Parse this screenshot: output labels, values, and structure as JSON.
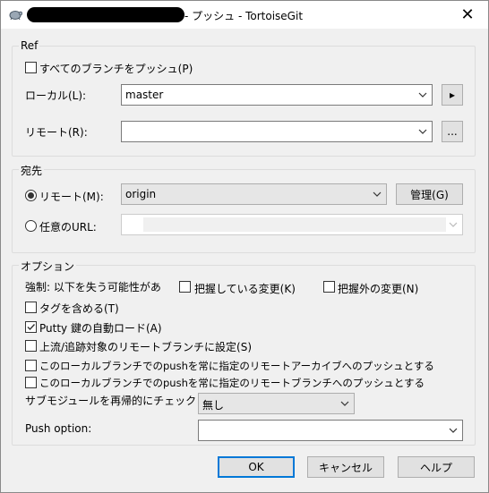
{
  "window": {
    "title": "- プッシュ - TortoiseGit",
    "close": "✕"
  },
  "ref": {
    "legend": "Ref",
    "push_all_branches": "すべてのブランチをプッシュ(P)",
    "local_label": "ローカル(L):",
    "local_value": "master",
    "local_button": "▸",
    "remote_label": "リモート(R):",
    "remote_value": "",
    "remote_button": "..."
  },
  "destination": {
    "legend": "宛先",
    "remote_label": "リモート(M):",
    "remote_value": "origin",
    "manage_button": "管理(G)",
    "url_label": "任意のURL:",
    "url_value": ""
  },
  "options": {
    "legend": "オプション",
    "force_label": "強制: 以下を失う可能性があ",
    "force_known": "把握している変更(K)",
    "force_unknown": "把握外の変更(N)",
    "include_tags": "タグを含める(T)",
    "putty_autoload": "Putty 鍵の自動ロード(A)",
    "set_upstream": "上流/追跡対象のリモートブランチに設定(S)",
    "always_push_archive": "このローカルブランチでのpushを常に指定のリモートアーカイブへのプッシュとする",
    "always_push_branch": "このローカルブランチでのpushを常に指定のリモートブランチへのプッシュとする",
    "recurse_label": "サブモジュールを再帰的にチェック",
    "recurse_value": "無し",
    "push_option_label": "Push option:",
    "push_option_value": "",
    "states": {
      "push_all": false,
      "force_known": false,
      "force_unknown": false,
      "include_tags": false,
      "putty_autoload": true,
      "set_upstream": false,
      "always_push_archive": false,
      "always_push_branch": false
    }
  },
  "buttons": {
    "ok": "OK",
    "cancel": "キャンセル",
    "help": "ヘルプ"
  }
}
